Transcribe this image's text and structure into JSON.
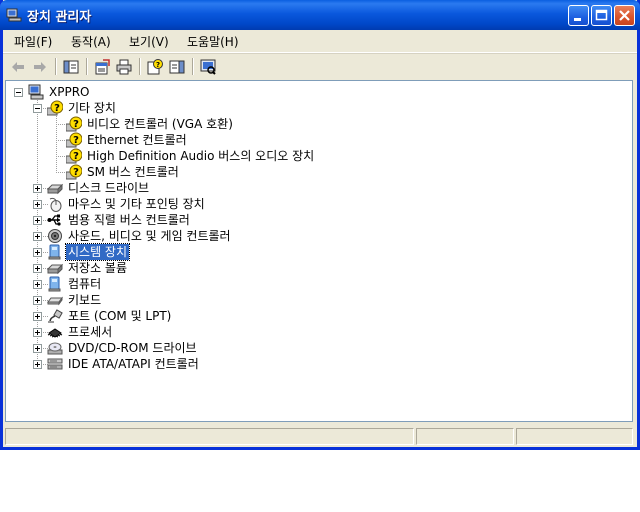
{
  "window": {
    "title": "장치 관리자"
  },
  "menu": [
    {
      "label": "파일(F)"
    },
    {
      "label": "동작(A)"
    },
    {
      "label": "보기(V)"
    },
    {
      "label": "도움말(H)"
    }
  ],
  "tree": {
    "root": "XPPRO",
    "other_devices": {
      "label": "기타 장치",
      "children": [
        "비디오 컨트롤러 (VGA 호환)",
        "Ethernet 컨트롤러",
        "High Definition Audio 버스의 오디오 장치",
        "SM 버스 컨트롤러"
      ]
    },
    "categories": [
      "디스크 드라이브",
      "마우스 및 기타 포인팅 장치",
      "범용 직렬 버스 컨트롤러",
      "사운드, 비디오 및 게임 컨트롤러",
      "시스템 장치",
      "저장소 볼륨",
      "컴퓨터",
      "키보드",
      "포트 (COM 및 LPT)",
      "프로세서",
      "DVD/CD-ROM 드라이브",
      "IDE ATA/ATAPI 컨트롤러"
    ],
    "selected": "시스템 장치"
  },
  "colors": {
    "title_bar": "#0a58dd",
    "selection": "#316ac5",
    "warning": "#ffde00"
  }
}
